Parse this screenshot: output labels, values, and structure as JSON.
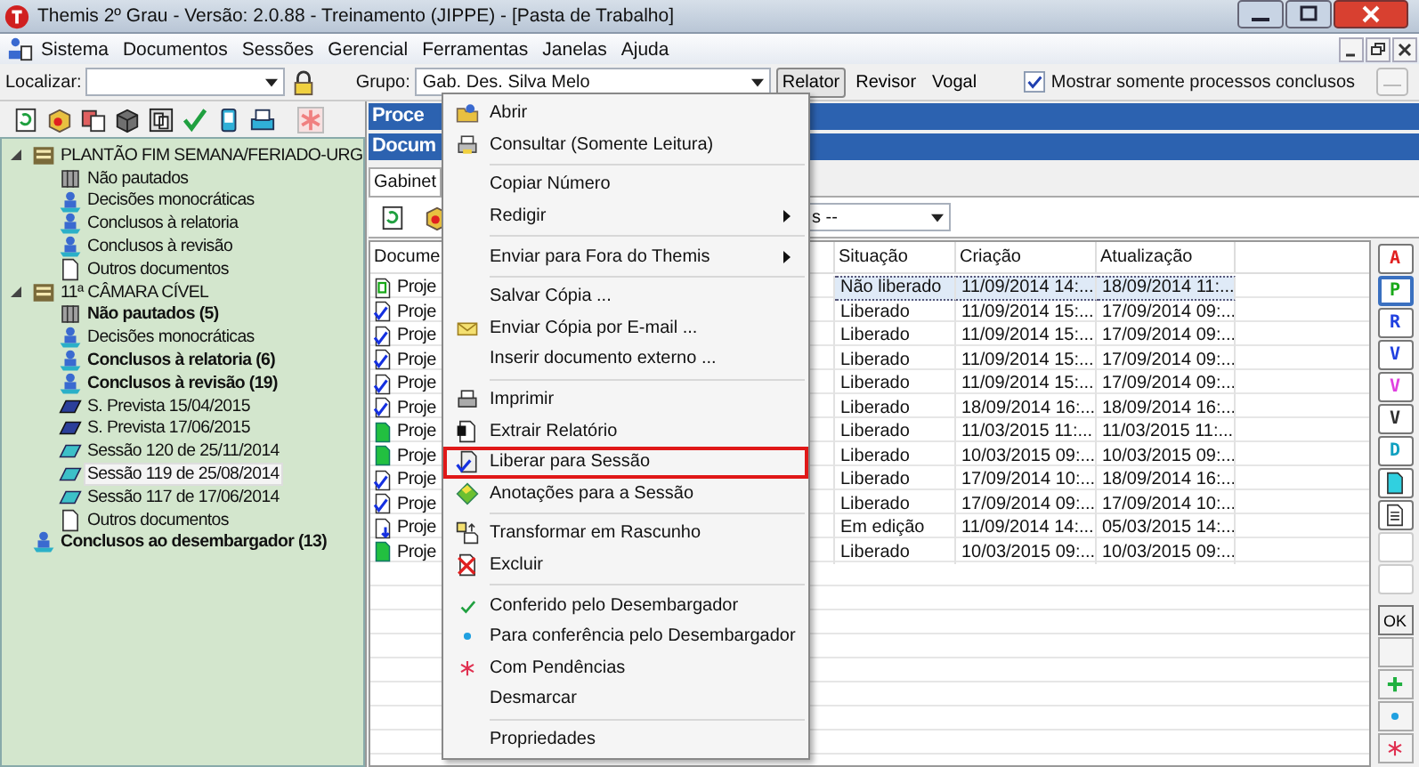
{
  "window": {
    "title": "Themis 2º Grau - Versão: 2.0.88 - Treinamento (JIPPE) - [Pasta de Trabalho]"
  },
  "menu_bar": [
    "Sistema",
    "Documentos",
    "Sessões",
    "Gerencial",
    "Ferramentas",
    "Janelas",
    "Ajuda"
  ],
  "toolbar": {
    "search_label": "Localizar:",
    "group_label": "Grupo:",
    "group_value": "Gab. Des. Silva Melo",
    "roles": [
      {
        "label": "Relator",
        "selected": true
      },
      {
        "label": "Revisor",
        "selected": false
      },
      {
        "label": "Vogal",
        "selected": false
      }
    ],
    "filter": {
      "label": "Mostrar somente processos conclusos",
      "checked": true
    }
  },
  "tree": [
    {
      "label": "PLANTÃO FIM SEMANA/FERIADO-URG",
      "kind": "folder",
      "bold": false,
      "selected": false,
      "expanded": true,
      "children": [
        {
          "label": "Não pautados",
          "kind": "grid",
          "bold": false,
          "selected": false
        },
        {
          "label": "Decisões monocráticas",
          "kind": "stack",
          "bold": false,
          "selected": false
        },
        {
          "label": "Conclusos à relatoria",
          "kind": "stack",
          "bold": false,
          "selected": false
        },
        {
          "label": "Conclusos à revisão",
          "kind": "stack",
          "bold": false,
          "selected": false
        },
        {
          "label": "Outros documentos",
          "kind": "doc",
          "bold": false,
          "selected": false
        }
      ]
    },
    {
      "label": "11ª CÂMARA CÍVEL",
      "kind": "folder",
      "bold": false,
      "selected": false,
      "expanded": true,
      "children": [
        {
          "label": "Não pautados (5)",
          "kind": "grid",
          "bold": true,
          "selected": false
        },
        {
          "label": "Decisões monocráticas",
          "kind": "stack",
          "bold": false,
          "selected": false
        },
        {
          "label": "Conclusos à relatoria (6)",
          "kind": "stack",
          "bold": true,
          "selected": false
        },
        {
          "label": "Conclusos à revisão (19)",
          "kind": "stack",
          "bold": true,
          "selected": false
        },
        {
          "label": "S. Prevista 15/04/2015",
          "kind": "planned",
          "bold": false,
          "selected": false
        },
        {
          "label": "S. Prevista 17/06/2015",
          "kind": "planned",
          "bold": false,
          "selected": false
        },
        {
          "label": "Sessão 120 de 25/11/2014",
          "kind": "session",
          "bold": false,
          "selected": false
        },
        {
          "label": "Sessão 119 de 25/08/2014",
          "kind": "session",
          "bold": false,
          "selected": true
        },
        {
          "label": "Sessão 117 de 17/06/2014",
          "kind": "session",
          "bold": false,
          "selected": false
        },
        {
          "label": "Outros documentos",
          "kind": "doc",
          "bold": false,
          "selected": false
        }
      ]
    },
    {
      "label": "Conclusos ao desembargador (13)",
      "kind": "stack",
      "bold": true,
      "selected": false
    }
  ],
  "panel_headers": [
    "Proce",
    "Docum"
  ],
  "tab": "Gabinet",
  "doc_filter": "s --",
  "table": {
    "columns": [
      "Docume",
      "Situação",
      "Criação",
      "Atualização"
    ],
    "rows": [
      {
        "kind": "p_doc",
        "document": "Proje",
        "status": "Não liberado",
        "created": "11/09/2014 14:...",
        "updated": "18/09/2014 11:...",
        "selected": true
      },
      {
        "kind": "check_doc",
        "document": "Proje",
        "status": "Liberado",
        "created": "11/09/2014 15:...",
        "updated": "17/09/2014 09:...",
        "selected": false
      },
      {
        "kind": "check_doc",
        "document": "Proje",
        "status": "Liberado",
        "created": "11/09/2014 15:...",
        "updated": "17/09/2014 09:...",
        "selected": false
      },
      {
        "kind": "check_doc",
        "document": "Proje",
        "status": "Liberado",
        "created": "11/09/2014 15:...",
        "updated": "17/09/2014 09:...",
        "selected": false
      },
      {
        "kind": "check_doc",
        "document": "Proje",
        "status": "Liberado",
        "created": "11/09/2014 15:...",
        "updated": "17/09/2014 09:...",
        "selected": false
      },
      {
        "kind": "check_doc",
        "document": "Proje",
        "status": "Liberado",
        "created": "18/09/2014 16:...",
        "updated": "18/09/2014 16:...",
        "selected": false
      },
      {
        "kind": "green_doc",
        "document": "Proje",
        "status": "Liberado",
        "created": "11/03/2015 11:...",
        "updated": "11/03/2015 11:...",
        "selected": false
      },
      {
        "kind": "green_doc",
        "document": "Proje",
        "status": "Liberado",
        "created": "10/03/2015 09:...",
        "updated": "10/03/2015 09:...",
        "selected": false
      },
      {
        "kind": "check_doc",
        "document": "Proje",
        "status": "Liberado",
        "created": "17/09/2014 10:...",
        "updated": "18/09/2014 16:...",
        "selected": false
      },
      {
        "kind": "check_doc",
        "document": "Proje",
        "status": "Liberado",
        "created": "17/09/2014 09:...",
        "updated": "17/09/2014 10:...",
        "selected": false
      },
      {
        "kind": "arrow_doc",
        "document": "Proje",
        "status": "Em edição",
        "created": "11/09/2014 14:...",
        "updated": "05/03/2015 14:...",
        "selected": false
      },
      {
        "kind": "green_doc",
        "document": "Proje",
        "status": "Liberado",
        "created": "10/03/2015 09:...",
        "updated": "10/03/2015 09:...",
        "selected": false
      }
    ]
  },
  "side_buttons": [
    {
      "kind": "letter",
      "label": "A",
      "color": "#e02020",
      "selected": false
    },
    {
      "kind": "letter",
      "label": "P",
      "color": "#18a818",
      "selected": true
    },
    {
      "kind": "letter",
      "label": "R",
      "color": "#2040e0",
      "selected": false
    },
    {
      "kind": "letter",
      "label": "V",
      "color": "#2040e0",
      "selected": false
    },
    {
      "kind": "letter",
      "label": "V",
      "color": "#e040e0",
      "selected": false
    },
    {
      "kind": "letter",
      "label": "V",
      "color": "#303030",
      "selected": false
    },
    {
      "kind": "letter",
      "label": "D",
      "color": "#10a0c0",
      "selected": false
    },
    {
      "kind": "page_cyan",
      "selected": false
    },
    {
      "kind": "page_lines",
      "selected": false
    },
    {
      "kind": "blank",
      "selected": false
    },
    {
      "kind": "blank",
      "selected": false
    }
  ],
  "ok_button": "OK",
  "mark_buttons": [
    {
      "kind": "blank"
    },
    {
      "kind": "plus"
    },
    {
      "kind": "dot"
    },
    {
      "kind": "asterisk"
    }
  ],
  "context_menu": [
    {
      "kind": "open",
      "label": "Abrir",
      "submenu": false,
      "highlighted": false
    },
    {
      "kind": "view",
      "label": "Consultar (Somente Leitura)",
      "submenu": false,
      "highlighted": false
    },
    {
      "kind": "separator"
    },
    {
      "kind": "plain",
      "label": "Copiar Número",
      "submenu": false,
      "highlighted": false
    },
    {
      "kind": "plain",
      "label": "Redigir",
      "submenu": true,
      "highlighted": false
    },
    {
      "kind": "separator"
    },
    {
      "kind": "plain",
      "label": "Enviar para Fora do Themis",
      "submenu": true,
      "highlighted": false
    },
    {
      "kind": "separator"
    },
    {
      "kind": "plain",
      "label": "Salvar Cópia ...",
      "submenu": false,
      "highlighted": false
    },
    {
      "kind": "mail",
      "label": "Enviar Cópia por E-mail ...",
      "submenu": false,
      "highlighted": false
    },
    {
      "kind": "plain",
      "label": "Inserir documento externo ...",
      "submenu": false,
      "highlighted": false
    },
    {
      "kind": "separator"
    },
    {
      "kind": "print",
      "label": "Imprimir",
      "submenu": false,
      "highlighted": false
    },
    {
      "kind": "report",
      "label": "Extrair Relatório",
      "submenu": false,
      "highlighted": false
    },
    {
      "kind": "release",
      "label": "Liberar para Sessão",
      "submenu": false,
      "highlighted": true
    },
    {
      "kind": "note",
      "label": "Anotações para a Sessão",
      "submenu": false,
      "highlighted": false
    },
    {
      "kind": "separator"
    },
    {
      "kind": "draft",
      "label": "Transformar em Rascunho",
      "submenu": false,
      "highlighted": false
    },
    {
      "kind": "delete",
      "label": "Excluir",
      "submenu": false,
      "highlighted": false
    },
    {
      "kind": "separator"
    },
    {
      "kind": "check",
      "label": "Conferido pelo Desembargador",
      "submenu": false,
      "highlighted": false
    },
    {
      "kind": "dot",
      "label": "Para conferência pelo Desembargador",
      "submenu": false,
      "highlighted": false
    },
    {
      "kind": "asterisk",
      "label": "Com Pendências",
      "submenu": false,
      "highlighted": false
    },
    {
      "kind": "plain",
      "label": "Desmarcar",
      "submenu": false,
      "highlighted": false
    },
    {
      "kind": "separator"
    },
    {
      "kind": "plain",
      "label": "Propriedades",
      "submenu": false,
      "highlighted": false
    }
  ]
}
